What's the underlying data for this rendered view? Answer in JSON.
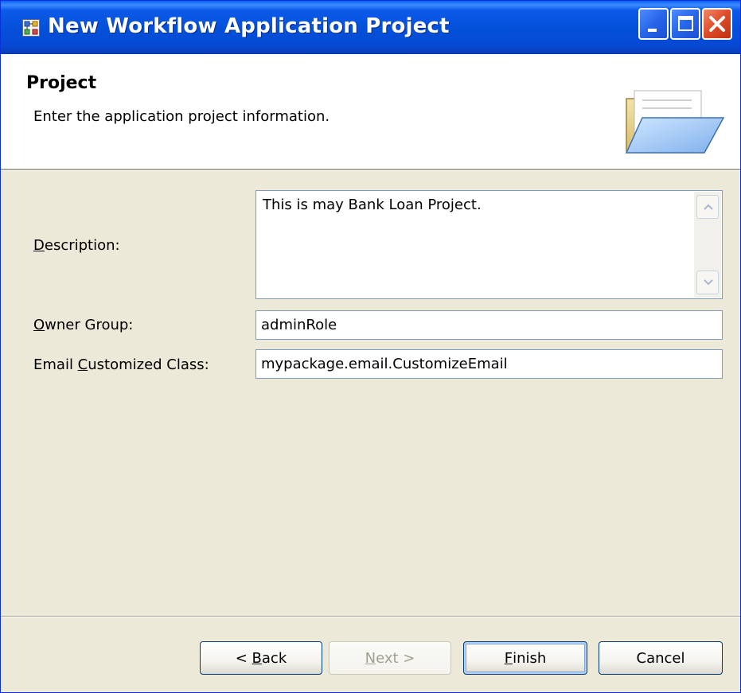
{
  "window": {
    "title": "New Workflow Application Project",
    "controls": [
      "minimize-icon",
      "maximize-icon",
      "close-icon"
    ]
  },
  "header": {
    "title": "Project",
    "description": "Enter the application project information.",
    "icon": "open-folder-icon"
  },
  "form": {
    "description": {
      "label_mnemonic": "D",
      "label_rest": "escription:",
      "value": "This is may Bank Loan Project."
    },
    "owner_group": {
      "label_mnemonic": "O",
      "label_rest": "wner Group:",
      "value": "adminRole"
    },
    "email_class": {
      "label_prefix": "Email ",
      "label_mnemonic": "C",
      "label_rest": "ustomized Class:",
      "value": "mypackage.email.CustomizeEmail"
    }
  },
  "buttons": {
    "back": {
      "prefix": "< ",
      "mnemonic": "B",
      "rest": "ack"
    },
    "next": {
      "mnemonic": "N",
      "rest": "ext >"
    },
    "finish": {
      "mnemonic": "F",
      "rest": "inish"
    },
    "cancel": {
      "label": "Cancel"
    }
  },
  "colors": {
    "titlebar": "#0450d8",
    "dialog_bg": "#ece9d8",
    "close_button": "#de4a26",
    "field_border": "#7f9db9"
  }
}
